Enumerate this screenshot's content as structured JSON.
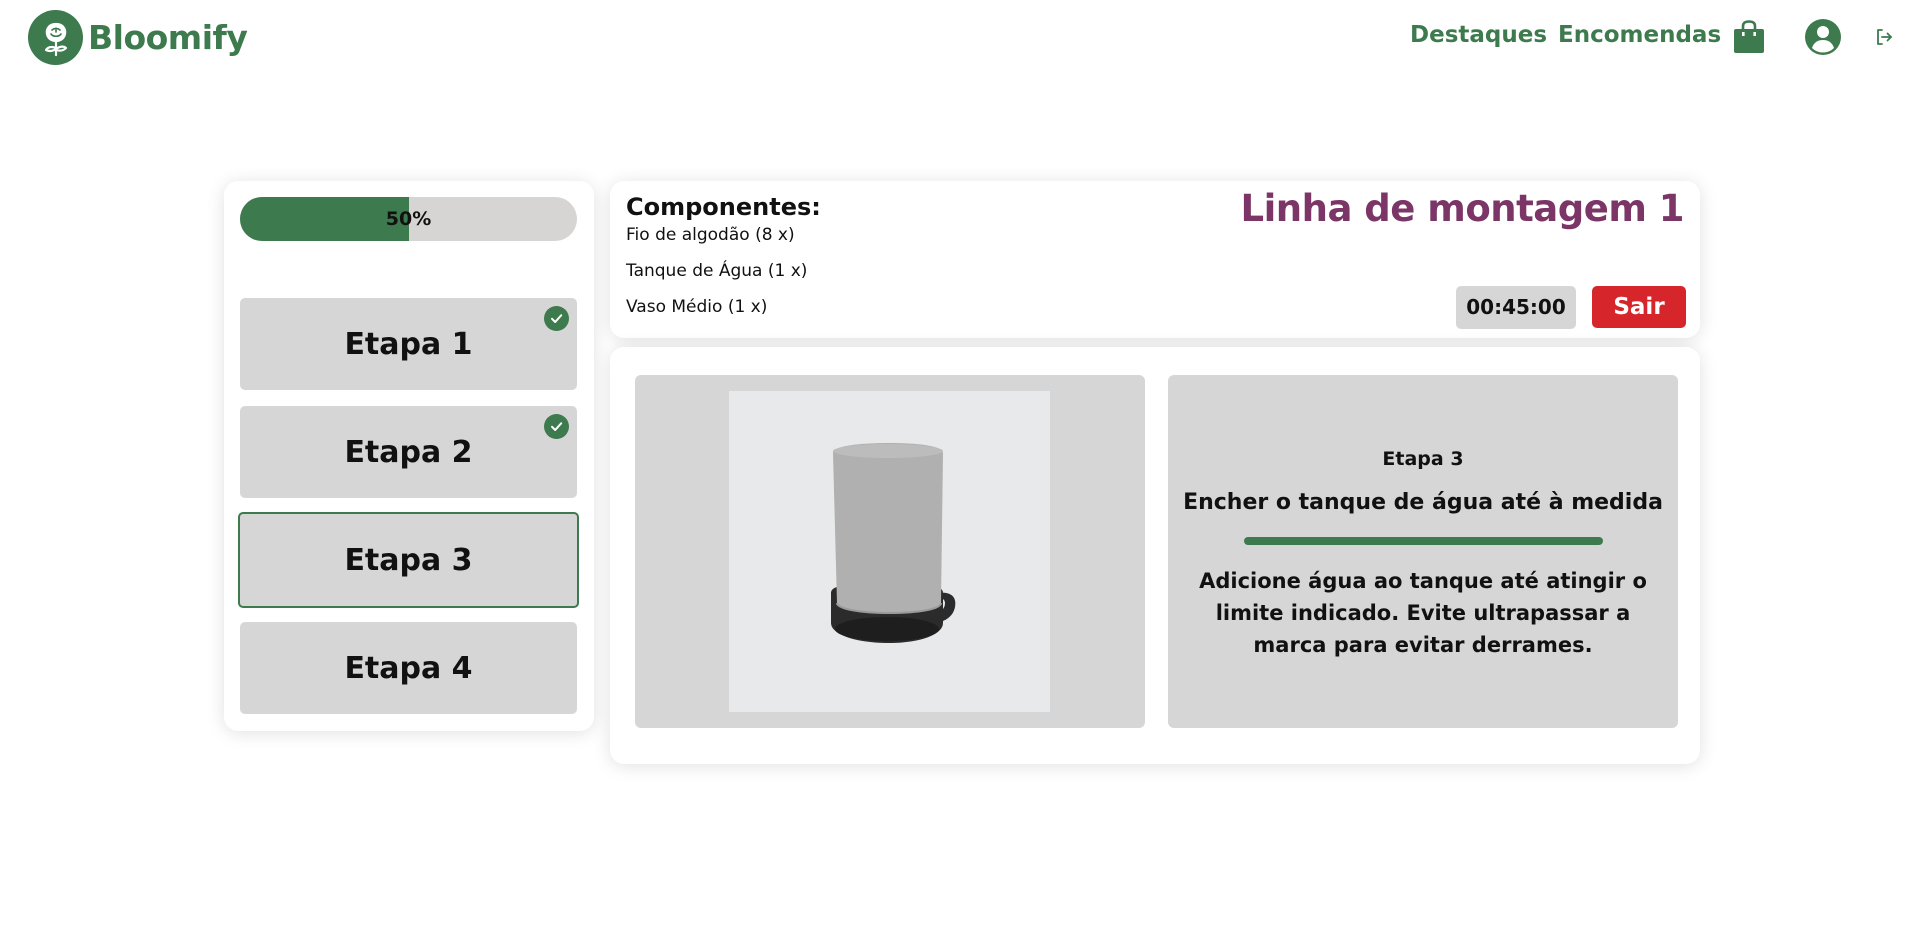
{
  "header": {
    "brand": "Bloomify",
    "nav": {
      "highlights": "Destaques",
      "orders": "Encomendas"
    },
    "icons": [
      "rose-logo-icon",
      "shopping-bag-icon",
      "user-account-icon",
      "logout-icon"
    ]
  },
  "sidebar": {
    "progress": {
      "label": "50%",
      "value": 0.5
    },
    "steps": [
      {
        "label": "Etapa 1",
        "completed": true
      },
      {
        "label": "Etapa 2",
        "completed": true
      },
      {
        "label": "Etapa 3",
        "completed": false,
        "active": true
      },
      {
        "label": "Etapa 4",
        "completed": false
      }
    ]
  },
  "info": {
    "components_title": "Componentes:",
    "components": [
      "Fio de algodão (8 x)",
      "Tanque de Água (1 x)",
      "Vaso Médio (1 x)"
    ],
    "line_title": "Linha de montagem 1",
    "timer": "00:45:00",
    "exit_label": "Sair"
  },
  "step_detail": {
    "number": "Etapa 3",
    "title": "Encher o tanque de água até à medida",
    "description": "Adicione água ao tanque até atingir o limite indicado. Evite ultrapassar a marca para evitar derrames."
  },
  "colors": {
    "brand_green": "#3d7a4d",
    "title_purple": "#7b3567",
    "exit_red": "#d7262b",
    "card_gray": "#d6d6d6"
  }
}
